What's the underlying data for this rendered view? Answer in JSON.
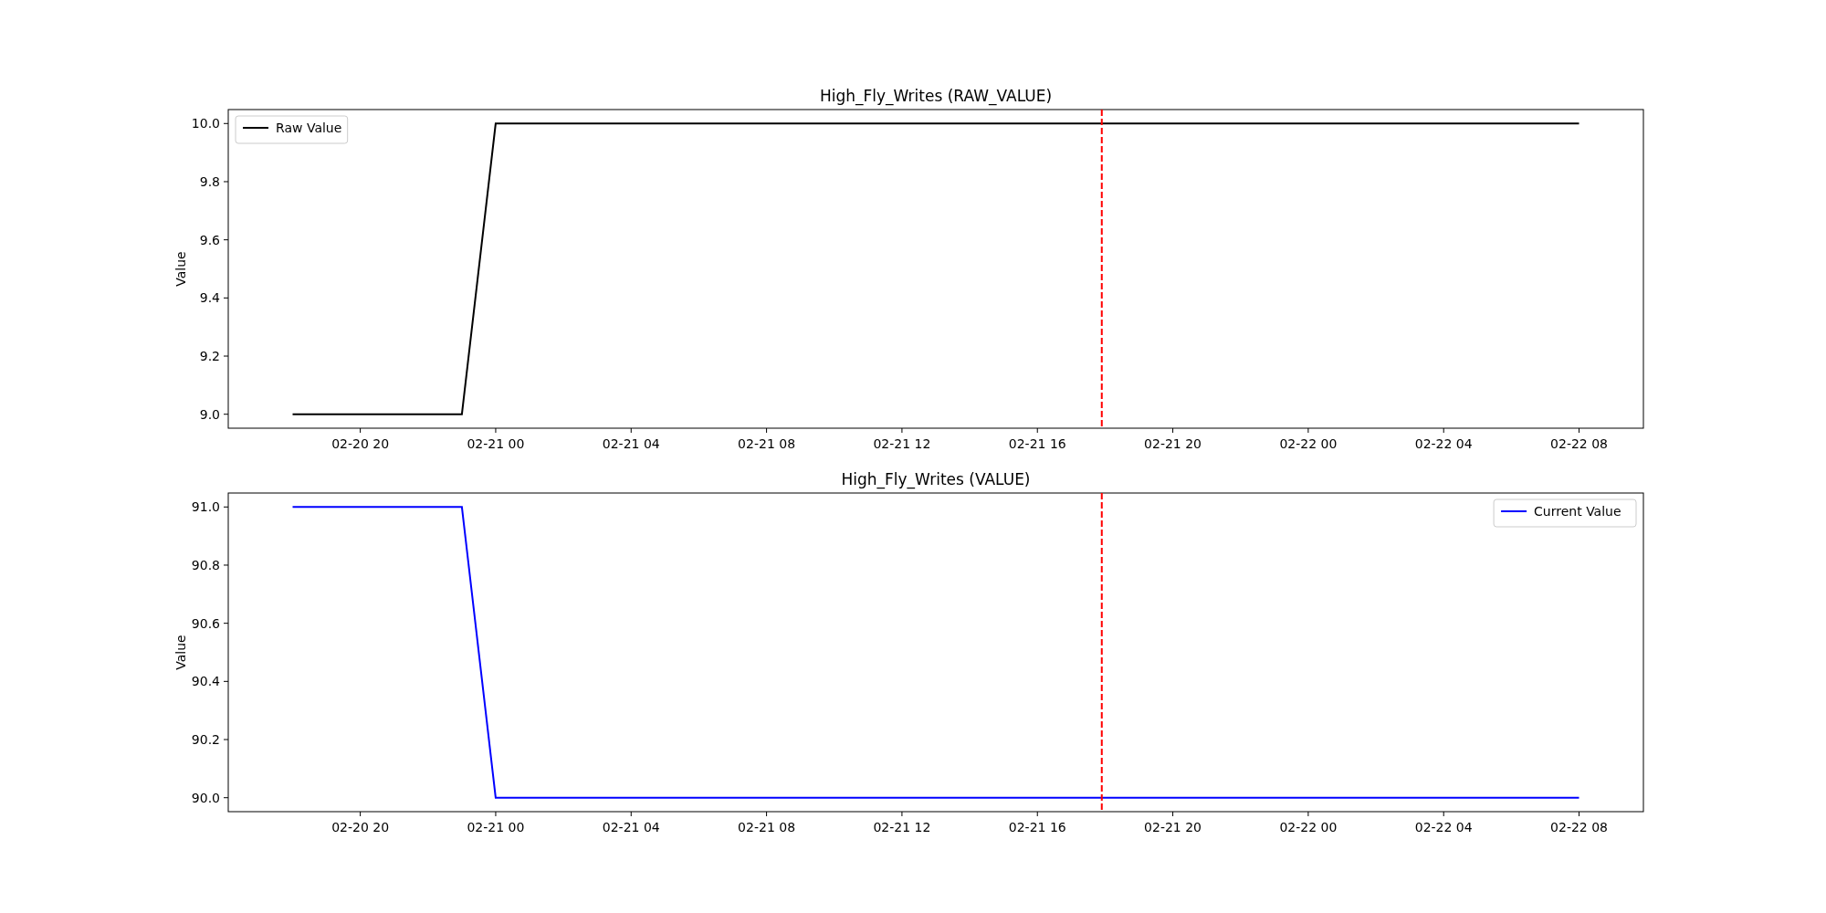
{
  "plots": [
    {
      "chart_data": {
        "type": "line",
        "title": "High_Fly_Writes (RAW_VALUE)",
        "ylabel": "Value",
        "categories": [
          null,
          null,
          "02-20 20",
          null,
          null,
          null,
          "02-21 00",
          null,
          null,
          null,
          "02-21 04",
          null,
          null,
          null,
          "02-21 08",
          null,
          null,
          null,
          "02-21 12",
          null,
          null,
          null,
          "02-21 16",
          null,
          null,
          null,
          "02-21 20",
          null,
          null,
          null,
          "02-22 00",
          null,
          null,
          null,
          "02-22 04",
          null,
          null,
          null,
          "02-22 08"
        ],
        "series": [
          {
            "name": "Raw Value",
            "color": "#000000",
            "values": [
              9.0,
              9.0,
              9.0,
              9.0,
              9.0,
              9.0,
              10.0,
              10.0,
              10.0,
              10.0,
              10.0,
              10.0,
              10.0,
              10.0,
              10.0,
              10.0,
              10.0,
              10.0,
              10.0,
              10.0,
              10.0,
              10.0,
              10.0,
              10.0,
              10.0,
              10.0,
              10.0,
              10.0,
              10.0,
              10.0,
              10.0,
              10.0,
              10.0,
              10.0,
              10.0,
              10.0,
              10.0,
              10.0,
              10.0
            ]
          }
        ],
        "ylim": [
          8.952,
          10.048
        ],
        "yticks": [
          {
            "value": 9.0,
            "label": "9.0"
          },
          {
            "value": 9.2,
            "label": "9.2"
          },
          {
            "value": 9.4,
            "label": "9.4"
          },
          {
            "value": 9.6,
            "label": "9.6"
          },
          {
            "value": 9.8,
            "label": "9.8"
          },
          {
            "value": 10.0,
            "label": "10.0"
          }
        ]
      }
    },
    {
      "chart_data": {
        "type": "line",
        "title": "High_Fly_Writes (VALUE)",
        "ylabel": "Value",
        "categories": [
          null,
          null,
          "02-20 20",
          null,
          null,
          null,
          "02-21 00",
          null,
          null,
          null,
          "02-21 04",
          null,
          null,
          null,
          "02-21 08",
          null,
          null,
          null,
          "02-21 12",
          null,
          null,
          null,
          "02-21 16",
          null,
          null,
          null,
          "02-21 20",
          null,
          null,
          null,
          "02-22 00",
          null,
          null,
          null,
          "02-22 04",
          null,
          null,
          null,
          "02-22 08"
        ],
        "series": [
          {
            "name": "Current Value",
            "color": "#0000ff",
            "values": [
              91.0,
              91.0,
              91.0,
              91.0,
              91.0,
              91.0,
              90.0,
              90.0,
              90.0,
              90.0,
              90.0,
              90.0,
              90.0,
              90.0,
              90.0,
              90.0,
              90.0,
              90.0,
              90.0,
              90.0,
              90.0,
              90.0,
              90.0,
              90.0,
              90.0,
              90.0,
              90.0,
              90.0,
              90.0,
              90.0,
              90.0,
              90.0,
              90.0,
              90.0,
              90.0,
              90.0,
              90.0,
              90.0,
              90.0
            ]
          }
        ],
        "ylim": [
          89.952,
          91.048
        ],
        "yticks": [
          {
            "value": 90.0,
            "label": "90.0"
          },
          {
            "value": 90.2,
            "label": "90.2"
          },
          {
            "value": 90.4,
            "label": "90.4"
          },
          {
            "value": 90.6,
            "label": "90.6"
          },
          {
            "value": 90.8,
            "label": "90.8"
          },
          {
            "value": 91.0,
            "label": "91.0"
          }
        ]
      }
    }
  ]
}
